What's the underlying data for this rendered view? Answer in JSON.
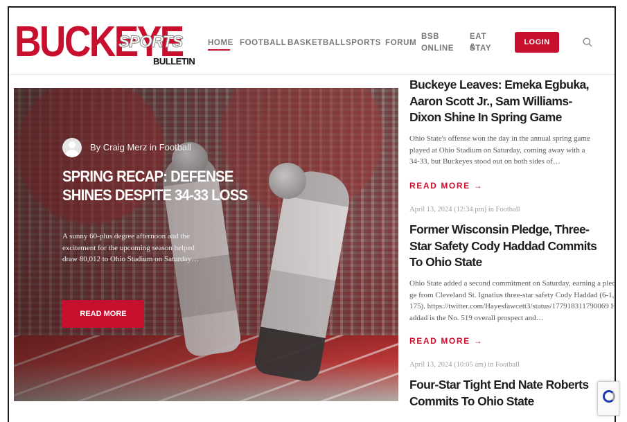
{
  "logo": {
    "word1": "BUCKEYE",
    "word2": "SPORTS",
    "word3": "BULLETIN"
  },
  "nav": {
    "items": [
      "HOME",
      "FOOTBALL",
      "BASKETBALL",
      "SPORTS",
      "FORUM",
      "BSB",
      "ONLINE",
      "EAT &",
      "STAY"
    ],
    "active": "HOME",
    "login_label": "LOGIN"
  },
  "hero": {
    "byline": "By Craig Merz in Football",
    "title": "SPRING RECAP: DEFENSE SHINES DESPITE 34-33 LOSS",
    "excerpt": "A sunny 60-plus degree afternoon and the excitement for the upcoming season helped draw 80,012 to Ohio Stadium on Saturday…",
    "button_label": "READ MORE"
  },
  "articles": [
    {
      "title": "Buckeye Leaves: Emeka Egbuka, Aaron Scott Jr., Sam Williams-Dixon Shine In Spring Game",
      "excerpt": "Ohio State's offense won the day in the annual spring game played at Ohio Stadium on Saturday, coming away with a 34-33, but Buckeyes stood out on both sides of…",
      "read_more": "READ MORE →"
    },
    {
      "meta": "April 13, 2024 (12:34 pm) in Football",
      "title": "Former Wisconsin Pledge, Three-Star Safety Cody Haddad Commits To Ohio State",
      "excerpt": "Ohio State added a second commitment on Saturday, earning a pledge from Cleveland St. Ignatius three-star safety Cody Haddad (6-1, 175). https://twitter.com/Hayesfawcett3/status/177918311790069 Haddad is the No. 519 overall prospect and…",
      "read_more": "READ MORE →"
    },
    {
      "meta": "April 13, 2024 (10:05 am) in Football",
      "title": "Four-Star Tight End Nate Roberts Commits To Ohio State"
    }
  ],
  "colors": {
    "brand_red": "#c8102e",
    "text_dark": "#1e1e1e",
    "meta_gray": "#a0a0a0"
  },
  "icons": {
    "search": "search-icon",
    "avatar": "user-avatar-icon",
    "recaptcha": "recaptcha-icon"
  }
}
